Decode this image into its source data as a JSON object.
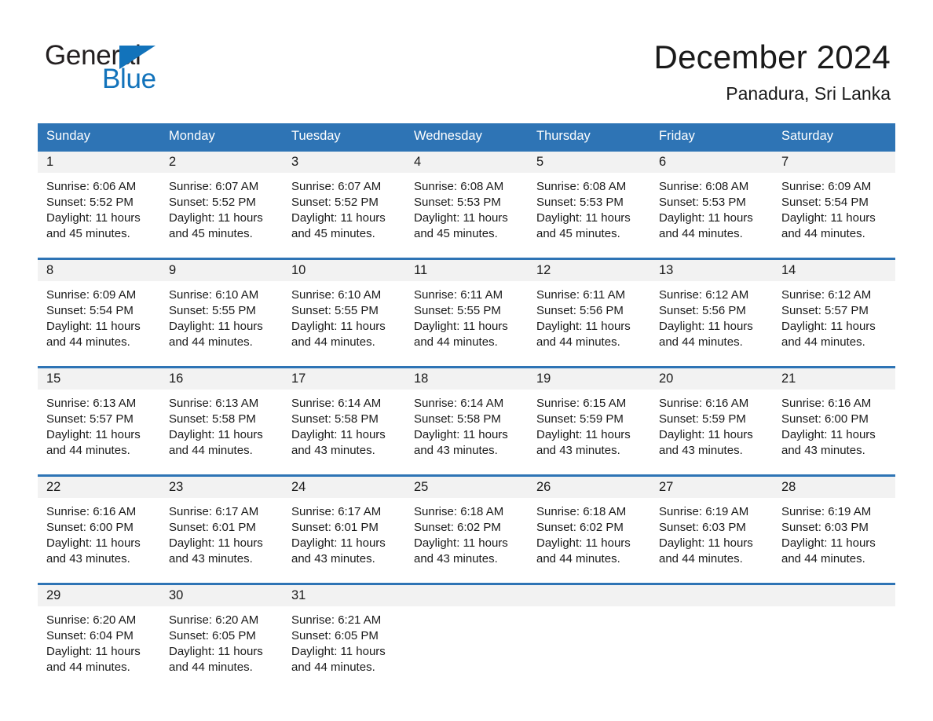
{
  "brand": {
    "name_part1": "General",
    "name_part2": "Blue",
    "triangle_icon": "triangle-icon",
    "accent_color": "#1273bb"
  },
  "header": {
    "title": "December 2024",
    "subtitle": "Panadura, Sri Lanka"
  },
  "colors": {
    "header_blue": "#2e74b5",
    "daynum_band": "#f2f2f2",
    "text": "#1a1a1a",
    "white": "#ffffff"
  },
  "weekday_headers": [
    "Sunday",
    "Monday",
    "Tuesday",
    "Wednesday",
    "Thursday",
    "Friday",
    "Saturday"
  ],
  "labels": {
    "sunrise_prefix": "Sunrise:",
    "sunset_prefix": "Sunset:",
    "daylight_prefix": "Daylight:"
  },
  "weeks": [
    {
      "days": [
        {
          "date": "1",
          "sunrise": "Sunrise: 6:06 AM",
          "sunset": "Sunset: 5:52 PM",
          "daylight": "Daylight: 11 hours and 45 minutes."
        },
        {
          "date": "2",
          "sunrise": "Sunrise: 6:07 AM",
          "sunset": "Sunset: 5:52 PM",
          "daylight": "Daylight: 11 hours and 45 minutes."
        },
        {
          "date": "3",
          "sunrise": "Sunrise: 6:07 AM",
          "sunset": "Sunset: 5:52 PM",
          "daylight": "Daylight: 11 hours and 45 minutes."
        },
        {
          "date": "4",
          "sunrise": "Sunrise: 6:08 AM",
          "sunset": "Sunset: 5:53 PM",
          "daylight": "Daylight: 11 hours and 45 minutes."
        },
        {
          "date": "5",
          "sunrise": "Sunrise: 6:08 AM",
          "sunset": "Sunset: 5:53 PM",
          "daylight": "Daylight: 11 hours and 45 minutes."
        },
        {
          "date": "6",
          "sunrise": "Sunrise: 6:08 AM",
          "sunset": "Sunset: 5:53 PM",
          "daylight": "Daylight: 11 hours and 44 minutes."
        },
        {
          "date": "7",
          "sunrise": "Sunrise: 6:09 AM",
          "sunset": "Sunset: 5:54 PM",
          "daylight": "Daylight: 11 hours and 44 minutes."
        }
      ]
    },
    {
      "days": [
        {
          "date": "8",
          "sunrise": "Sunrise: 6:09 AM",
          "sunset": "Sunset: 5:54 PM",
          "daylight": "Daylight: 11 hours and 44 minutes."
        },
        {
          "date": "9",
          "sunrise": "Sunrise: 6:10 AM",
          "sunset": "Sunset: 5:55 PM",
          "daylight": "Daylight: 11 hours and 44 minutes."
        },
        {
          "date": "10",
          "sunrise": "Sunrise: 6:10 AM",
          "sunset": "Sunset: 5:55 PM",
          "daylight": "Daylight: 11 hours and 44 minutes."
        },
        {
          "date": "11",
          "sunrise": "Sunrise: 6:11 AM",
          "sunset": "Sunset: 5:55 PM",
          "daylight": "Daylight: 11 hours and 44 minutes."
        },
        {
          "date": "12",
          "sunrise": "Sunrise: 6:11 AM",
          "sunset": "Sunset: 5:56 PM",
          "daylight": "Daylight: 11 hours and 44 minutes."
        },
        {
          "date": "13",
          "sunrise": "Sunrise: 6:12 AM",
          "sunset": "Sunset: 5:56 PM",
          "daylight": "Daylight: 11 hours and 44 minutes."
        },
        {
          "date": "14",
          "sunrise": "Sunrise: 6:12 AM",
          "sunset": "Sunset: 5:57 PM",
          "daylight": "Daylight: 11 hours and 44 minutes."
        }
      ]
    },
    {
      "days": [
        {
          "date": "15",
          "sunrise": "Sunrise: 6:13 AM",
          "sunset": "Sunset: 5:57 PM",
          "daylight": "Daylight: 11 hours and 44 minutes."
        },
        {
          "date": "16",
          "sunrise": "Sunrise: 6:13 AM",
          "sunset": "Sunset: 5:58 PM",
          "daylight": "Daylight: 11 hours and 44 minutes."
        },
        {
          "date": "17",
          "sunrise": "Sunrise: 6:14 AM",
          "sunset": "Sunset: 5:58 PM",
          "daylight": "Daylight: 11 hours and 43 minutes."
        },
        {
          "date": "18",
          "sunrise": "Sunrise: 6:14 AM",
          "sunset": "Sunset: 5:58 PM",
          "daylight": "Daylight: 11 hours and 43 minutes."
        },
        {
          "date": "19",
          "sunrise": "Sunrise: 6:15 AM",
          "sunset": "Sunset: 5:59 PM",
          "daylight": "Daylight: 11 hours and 43 minutes."
        },
        {
          "date": "20",
          "sunrise": "Sunrise: 6:16 AM",
          "sunset": "Sunset: 5:59 PM",
          "daylight": "Daylight: 11 hours and 43 minutes."
        },
        {
          "date": "21",
          "sunrise": "Sunrise: 6:16 AM",
          "sunset": "Sunset: 6:00 PM",
          "daylight": "Daylight: 11 hours and 43 minutes."
        }
      ]
    },
    {
      "days": [
        {
          "date": "22",
          "sunrise": "Sunrise: 6:16 AM",
          "sunset": "Sunset: 6:00 PM",
          "daylight": "Daylight: 11 hours and 43 minutes."
        },
        {
          "date": "23",
          "sunrise": "Sunrise: 6:17 AM",
          "sunset": "Sunset: 6:01 PM",
          "daylight": "Daylight: 11 hours and 43 minutes."
        },
        {
          "date": "24",
          "sunrise": "Sunrise: 6:17 AM",
          "sunset": "Sunset: 6:01 PM",
          "daylight": "Daylight: 11 hours and 43 minutes."
        },
        {
          "date": "25",
          "sunrise": "Sunrise: 6:18 AM",
          "sunset": "Sunset: 6:02 PM",
          "daylight": "Daylight: 11 hours and 43 minutes."
        },
        {
          "date": "26",
          "sunrise": "Sunrise: 6:18 AM",
          "sunset": "Sunset: 6:02 PM",
          "daylight": "Daylight: 11 hours and 44 minutes."
        },
        {
          "date": "27",
          "sunrise": "Sunrise: 6:19 AM",
          "sunset": "Sunset: 6:03 PM",
          "daylight": "Daylight: 11 hours and 44 minutes."
        },
        {
          "date": "28",
          "sunrise": "Sunrise: 6:19 AM",
          "sunset": "Sunset: 6:03 PM",
          "daylight": "Daylight: 11 hours and 44 minutes."
        }
      ]
    },
    {
      "days": [
        {
          "date": "29",
          "sunrise": "Sunrise: 6:20 AM",
          "sunset": "Sunset: 6:04 PM",
          "daylight": "Daylight: 11 hours and 44 minutes."
        },
        {
          "date": "30",
          "sunrise": "Sunrise: 6:20 AM",
          "sunset": "Sunset: 6:05 PM",
          "daylight": "Daylight: 11 hours and 44 minutes."
        },
        {
          "date": "31",
          "sunrise": "Sunrise: 6:21 AM",
          "sunset": "Sunset: 6:05 PM",
          "daylight": "Daylight: 11 hours and 44 minutes."
        },
        {
          "date": "",
          "sunrise": "",
          "sunset": "",
          "daylight": ""
        },
        {
          "date": "",
          "sunrise": "",
          "sunset": "",
          "daylight": ""
        },
        {
          "date": "",
          "sunrise": "",
          "sunset": "",
          "daylight": ""
        },
        {
          "date": "",
          "sunrise": "",
          "sunset": "",
          "daylight": ""
        }
      ]
    }
  ]
}
